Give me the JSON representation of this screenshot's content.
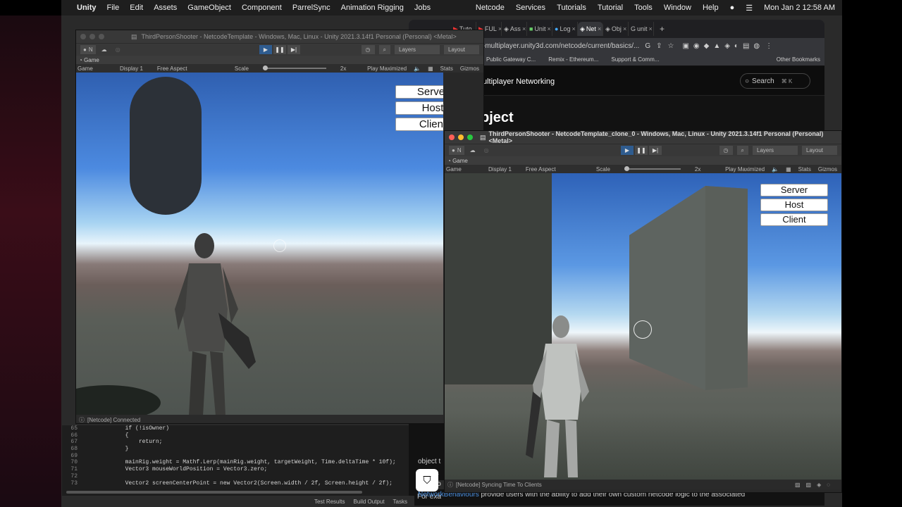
{
  "menubar": {
    "app": "Unity",
    "items": [
      "File",
      "Edit",
      "Assets",
      "GameObject",
      "Component",
      "ParrelSync",
      "Animation Rigging",
      "Jobs"
    ],
    "right_items": [
      "Netcode",
      "Services",
      "Tutorials",
      "Tutorial",
      "Tools",
      "Window",
      "Help"
    ],
    "datetime": "Mon Jan 2  12:58 AM"
  },
  "browser": {
    "tabs": [
      "Tuto",
      "FUL",
      "Ass",
      "Unit",
      "Log",
      "Net",
      "Obj",
      "unit"
    ],
    "address": "s-multiplayer.unity3d.com/netcode/current/basics/...",
    "bookmarks": [
      "Public Gateway C...",
      "Remix - Ethereum...",
      "Support & Comm..."
    ],
    "other_bookmarks": "Other Bookmarks",
    "nav_title": "ultiplayer Networking",
    "search_label": "Search",
    "search_shortcut": "⌘ K",
    "heading": "bject",
    "snippet_1": "associa",
    "code_word": "Netwo",
    "snippet_2": "For exa",
    "snippet_3": "object t",
    "footer_link": "NetworkBehaviours",
    "footer_text": " provide users with the ability to add their own custom netcode logic to the associated"
  },
  "editor1": {
    "title": "ThirdPersonShooter - NetcodeTemplate - Windows, Mac, Linux - Unity 2021.3.14f1 Personal (Personal) <Metal>",
    "account": "N",
    "layers": "Layers",
    "layout": "Layout",
    "game_tab": "Game",
    "game_dropdown": "Game",
    "display": "Display 1",
    "aspect": "Free Aspect",
    "scale_label": "Scale",
    "scale_value": "2x",
    "play_mode": "Play Maximized",
    "stats": "Stats",
    "gizmos": "Gizmos",
    "buttons": [
      "Server",
      "Host",
      "Client"
    ],
    "status": "[Netcode] Connected"
  },
  "editor2": {
    "title": "ThirdPersonShooter - NetcodeTemplate_clone_0 - Windows, Mac, Linux - Unity 2021.3.14f1 Personal (Personal) <Metal>",
    "account": "N",
    "layers": "Layers",
    "layout": "Layout",
    "game_tab": "Game",
    "game_dropdown": "Game",
    "display": "Display 1",
    "aspect": "Free Aspect",
    "scale_label": "Scale",
    "scale_value": "2x",
    "play_mode": "Play Maximized",
    "stats": "Stats",
    "gizmos": "Gizmos",
    "buttons": [
      "Server",
      "Host",
      "Client"
    ],
    "status": "[Netcode] Syncing Time To Clients"
  },
  "code": [
    {
      "n": "65",
      "t": "            if (!isOwner)"
    },
    {
      "n": "66",
      "t": "            {"
    },
    {
      "n": "67",
      "t": "                return;"
    },
    {
      "n": "68",
      "t": "            }"
    },
    {
      "n": "69",
      "t": ""
    },
    {
      "n": "70",
      "t": "            mainRig.weight = Mathf.Lerp(mainRig.weight, targetWeight, Time.deltaTime * 10f);"
    },
    {
      "n": "71",
      "t": "            Vector3 mouseWorldPosition = Vector3.zero;"
    },
    {
      "n": "72",
      "t": ""
    },
    {
      "n": "73",
      "t": "            Vector2 screenCenterPoint = new Vector2(Screen.width / 2f, Screen.height / 2f);"
    }
  ],
  "bottom_bar": [
    "Test Results",
    "Build Output",
    "Tasks"
  ]
}
